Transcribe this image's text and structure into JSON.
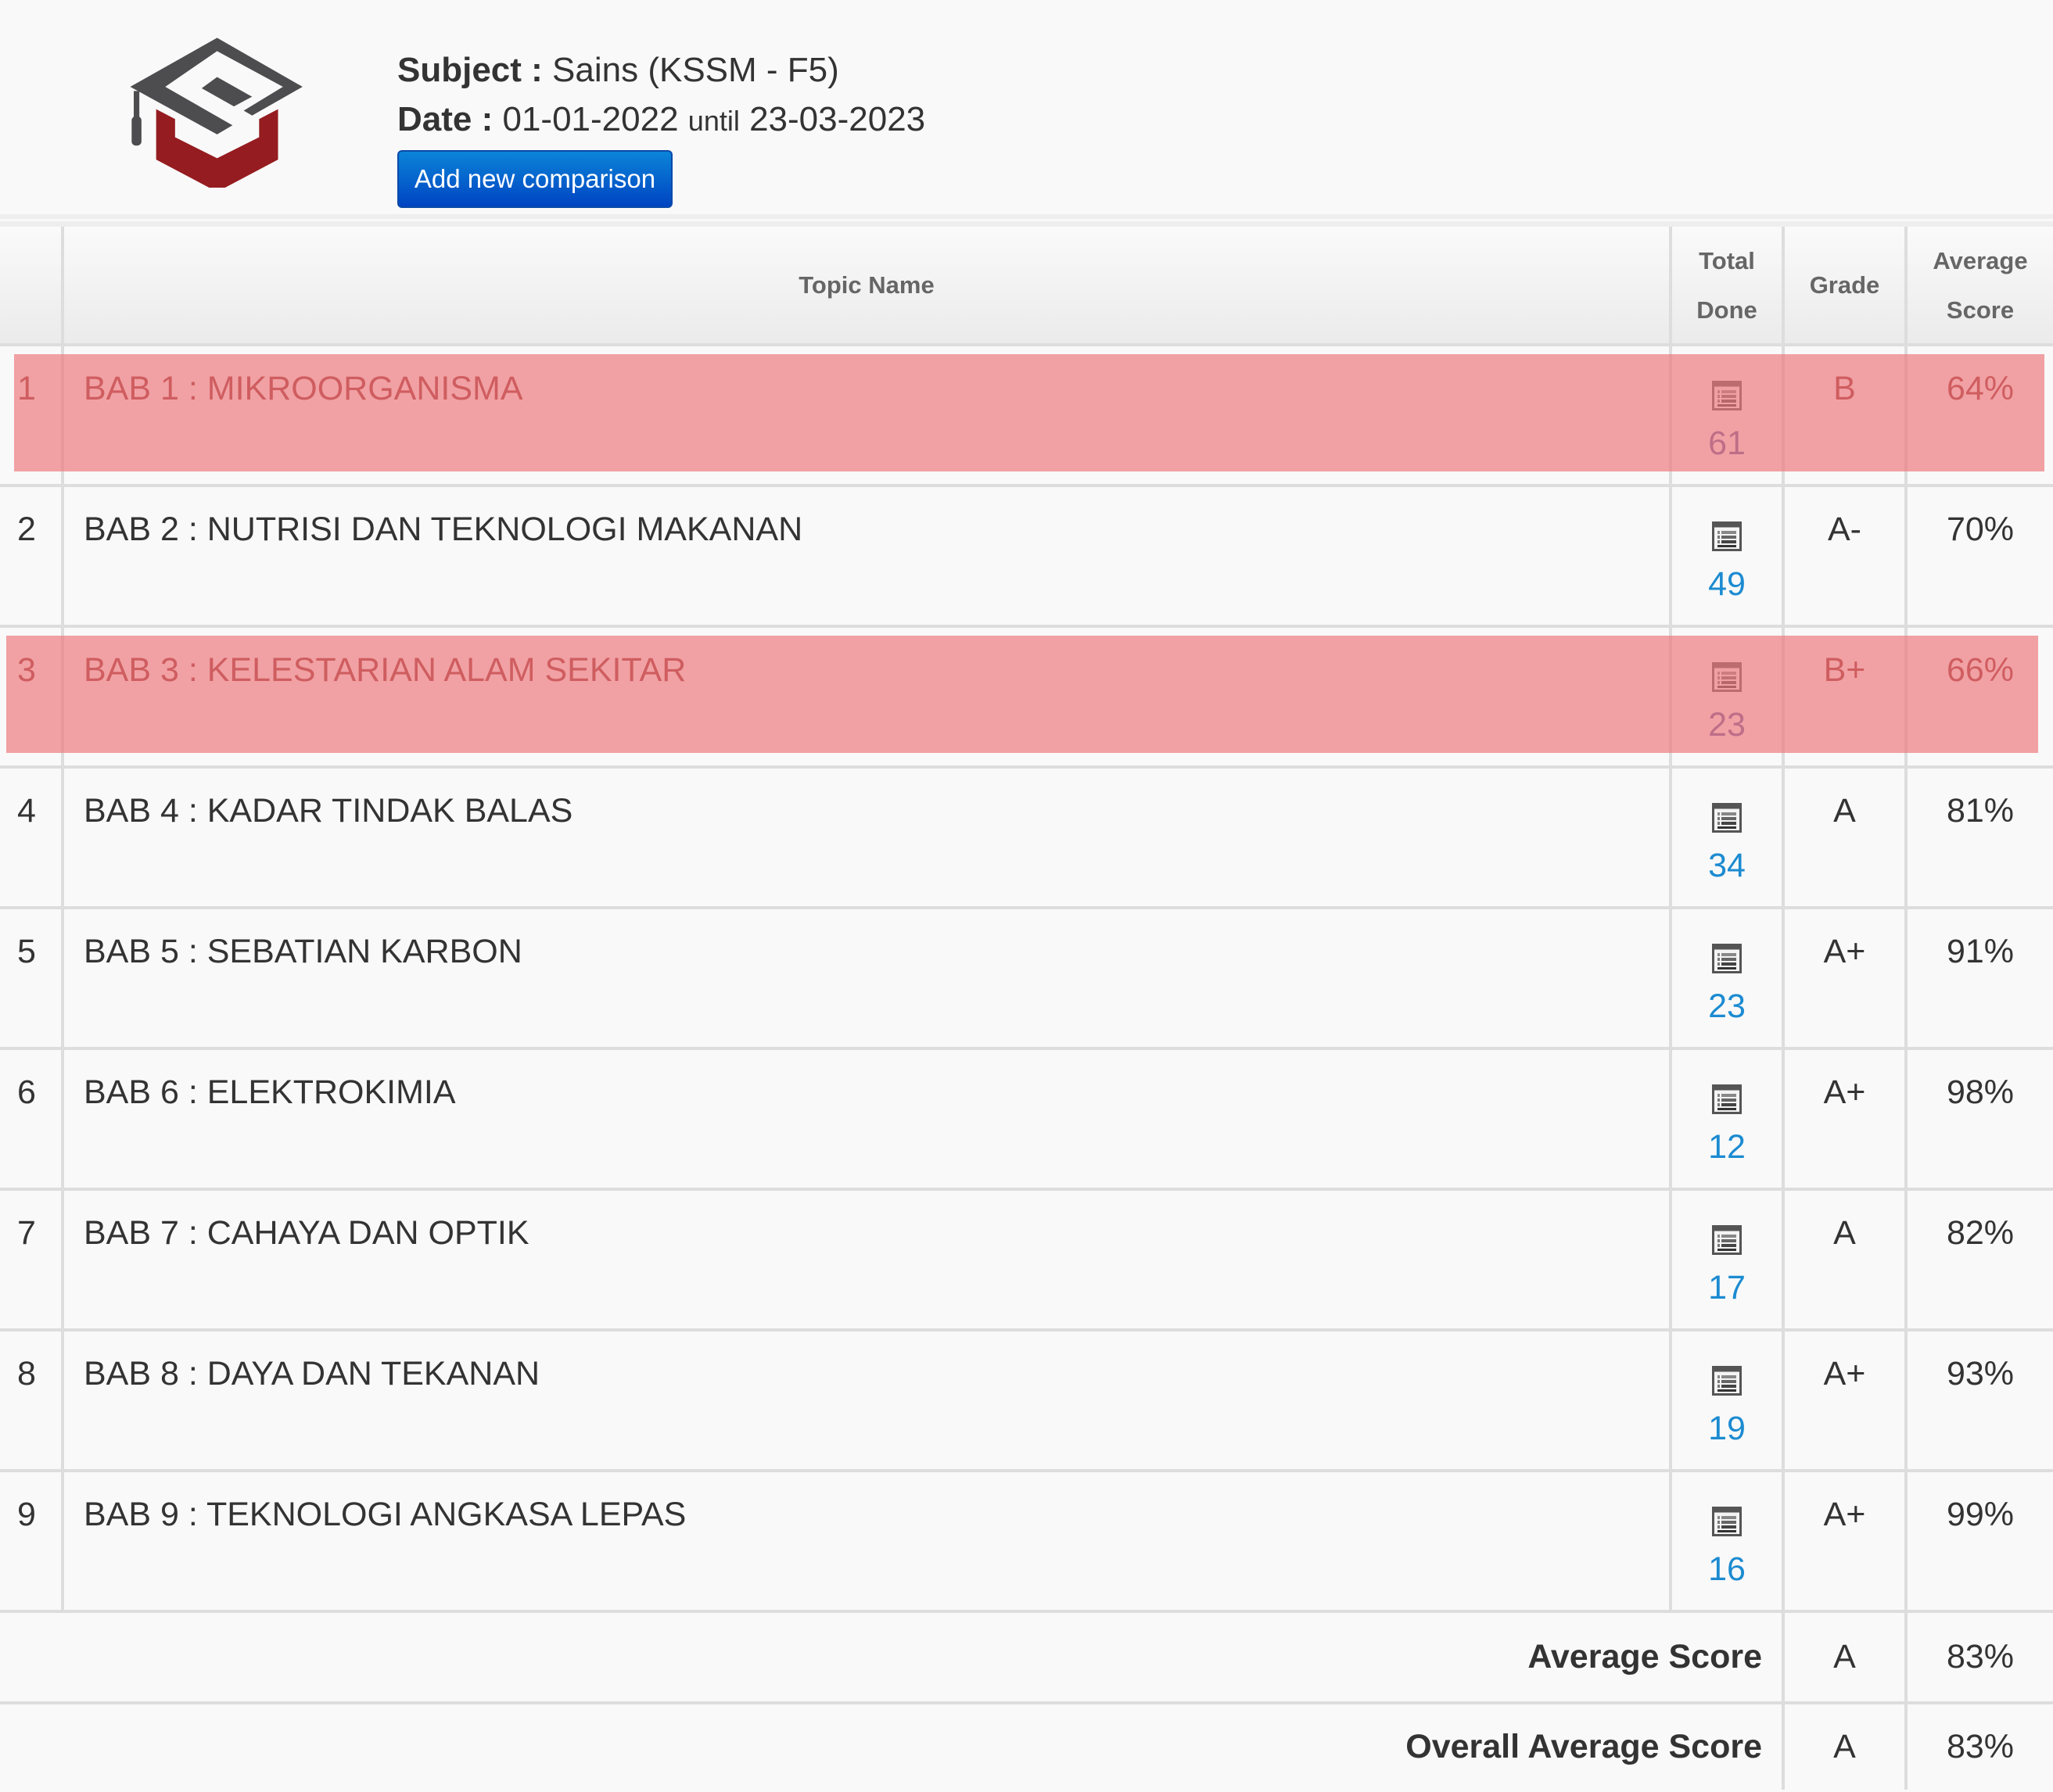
{
  "header": {
    "logo": "graduation-cap-logo",
    "subject_label": "Subject :",
    "subject_value": "Sains (KSSM - F5)",
    "date_label": "Date :",
    "date_from": "01-01-2022",
    "date_until_word": "until",
    "date_to": "23-03-2023",
    "add_button_label": "Add new comparison"
  },
  "colors": {
    "highlight": "#f3a0a2",
    "button": "#0a6fd0",
    "link": "#1c8bd1",
    "logo_gray": "#4d4d4f",
    "logo_red": "#951c20"
  },
  "table": {
    "columns": {
      "no": "",
      "topic": "Topic Name",
      "done_line1": "Total",
      "done_line2": "Done",
      "grade": "Grade",
      "avg_line1": "Average",
      "avg_line2": "Score"
    },
    "rows": [
      {
        "no": "1",
        "topic": "BAB 1 : MIKROORGANISMA",
        "icon": "list-icon",
        "done": "61",
        "grade": "B",
        "avg": "64%",
        "highlighted": true
      },
      {
        "no": "2",
        "topic": "BAB 2 : NUTRISI DAN TEKNOLOGI MAKANAN",
        "icon": "list-icon",
        "done": "49",
        "grade": "A-",
        "avg": "70%",
        "highlighted": false
      },
      {
        "no": "3",
        "topic": "BAB 3 : KELESTARIAN ALAM SEKITAR",
        "icon": "list-icon",
        "done": "23",
        "grade": "B+",
        "avg": "66%",
        "highlighted": true
      },
      {
        "no": "4",
        "topic": "BAB 4 : KADAR TINDAK BALAS",
        "icon": "list-icon",
        "done": "34",
        "grade": "A",
        "avg": "81%",
        "highlighted": false
      },
      {
        "no": "5",
        "topic": "BAB 5 : SEBATIAN KARBON",
        "icon": "list-icon",
        "done": "23",
        "grade": "A+",
        "avg": "91%",
        "highlighted": false
      },
      {
        "no": "6",
        "topic": "BAB 6 : ELEKTROKIMIA",
        "icon": "list-icon",
        "done": "12",
        "grade": "A+",
        "avg": "98%",
        "highlighted": false
      },
      {
        "no": "7",
        "topic": "BAB 7 : CAHAYA DAN OPTIK",
        "icon": "list-icon",
        "done": "17",
        "grade": "A",
        "avg": "82%",
        "highlighted": false
      },
      {
        "no": "8",
        "topic": "BAB 8 : DAYA DAN TEKANAN",
        "icon": "list-icon",
        "done": "19",
        "grade": "A+",
        "avg": "93%",
        "highlighted": false
      },
      {
        "no": "9",
        "topic": "BAB 9 : TEKNOLOGI ANGKASA LEPAS",
        "icon": "list-icon",
        "done": "16",
        "grade": "A+",
        "avg": "99%",
        "highlighted": false
      }
    ],
    "footer": [
      {
        "label": "Average Score",
        "grade": "A",
        "avg": "83%"
      },
      {
        "label": "Overall Average Score",
        "grade": "A",
        "avg": "83%"
      }
    ]
  }
}
